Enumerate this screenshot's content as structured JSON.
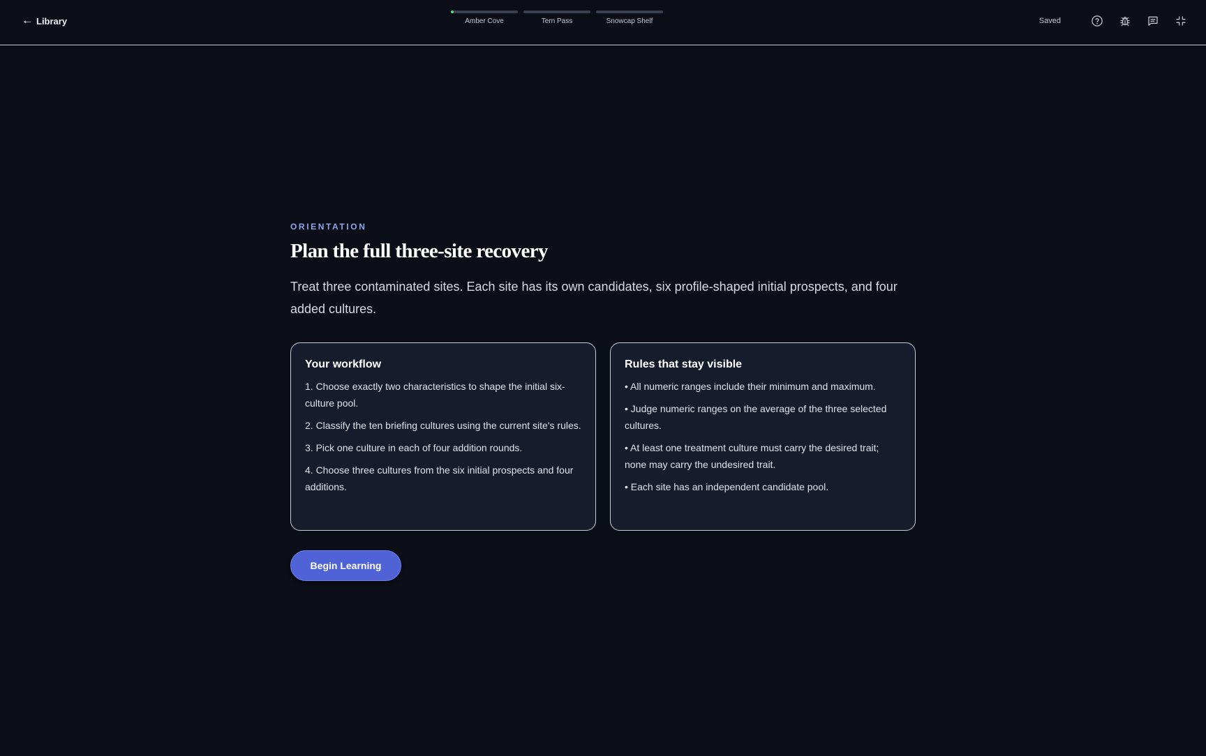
{
  "header": {
    "back_label": "Library",
    "steps": [
      {
        "label": "Amber Cove",
        "progress": 0.04
      },
      {
        "label": "Tern Pass",
        "progress": 0
      },
      {
        "label": "Snowcap Shelf",
        "progress": 0
      }
    ],
    "saved_label": "Saved",
    "icons": [
      "help-circle-icon",
      "bug-icon",
      "message-icon",
      "minimize-icon"
    ]
  },
  "main": {
    "eyebrow": "ORIENTATION",
    "title": "Plan the full three-site recovery",
    "intro": "Treat three contaminated sites. Each site has its own candidates, six profile-shaped initial prospects, and four added cultures.",
    "workflow": {
      "heading": "Your workflow",
      "items": [
        "1. Choose exactly two characteristics to shape the initial six-culture pool.",
        "2. Classify the ten briefing cultures using the current site's rules.",
        "3. Pick one culture in each of four addition rounds.",
        "4. Choose three cultures from the six initial prospects and four additions."
      ]
    },
    "rules": {
      "heading": "Rules that stay visible",
      "items": [
        "• All numeric ranges include their minimum and maximum.",
        "• Judge numeric ranges on the average of the three selected cultures.",
        "• At least one treatment culture must carry the desired trait; none may carry the undesired trait.",
        "• Each site has an independent candidate pool."
      ]
    },
    "cta_label": "Begin Learning"
  },
  "colors": {
    "background": "#0b0e17",
    "card": "#161c2c",
    "accent": "#4f63d6",
    "eyebrow": "#8fa4ea",
    "progress": "#4ade80"
  }
}
